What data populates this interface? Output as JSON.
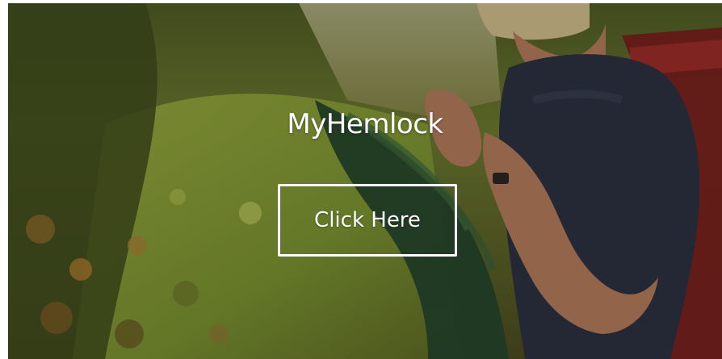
{
  "hero": {
    "title": "MyHemlock",
    "button_label": "Click Here",
    "background_image": "photo-person-examining-hemlock-branch-in-forest"
  },
  "colors": {
    "text": "#ffffff",
    "button_border": "#ffffff"
  }
}
